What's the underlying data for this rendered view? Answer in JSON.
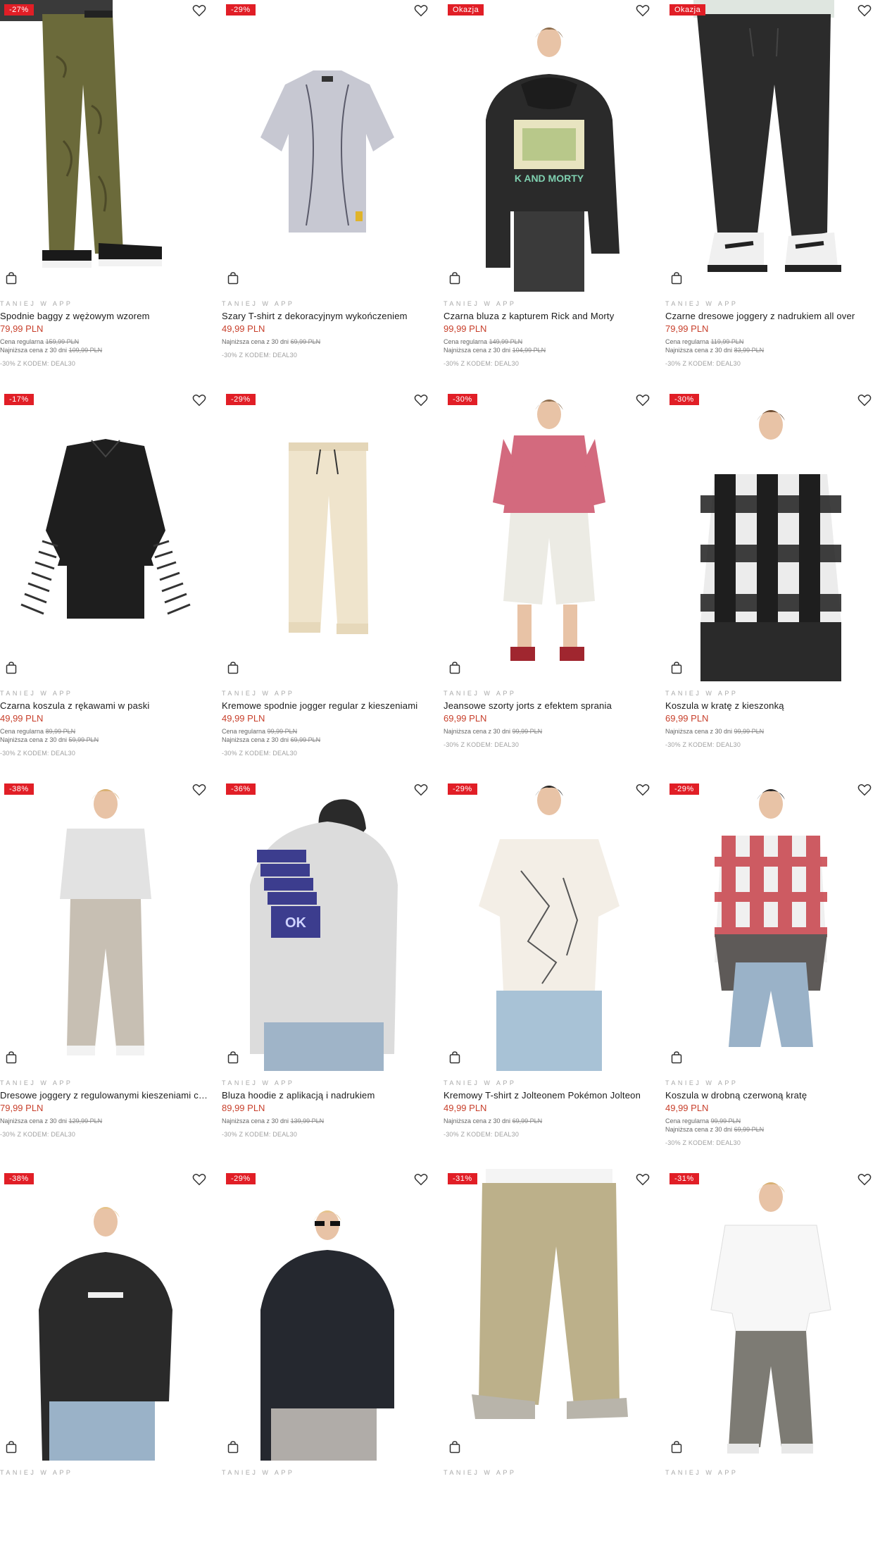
{
  "accent_badge": "#e11e26",
  "price_color": "#c8402c",
  "app_label": "TANIEJ W APP",
  "regular_label": "Cena regularna",
  "lowest_label": "Najniższa cena z 30 dni",
  "products": [
    {
      "badge": "-27%",
      "name": "Spodnie baggy z wężowym wzorem",
      "price": "79,99 PLN",
      "regular": "159,99 PLN",
      "lowest": "109,99 PLN",
      "code": "-30% Z KODEM: DEAL30",
      "image": "olive-snake-pants"
    },
    {
      "badge": "-29%",
      "name": "Szary T-shirt z dekoracyjnym wykończeniem",
      "price": "49,99 PLN",
      "regular": "",
      "lowest": "69,99 PLN",
      "code": "-30% Z KODEM: DEAL30",
      "image": "grey-tshirt"
    },
    {
      "badge": "Okazja",
      "name": "Czarna bluza z kapturem Rick and Morty",
      "price": "99,99 PLN",
      "regular": "149,99 PLN",
      "lowest": "104,99 PLN",
      "code": "-30% Z KODEM: DEAL30",
      "image": "black-hoodie-rick-morty"
    },
    {
      "badge": "Okazja",
      "name": "Czarne dresowe joggery z nadrukiem all over",
      "price": "79,99 PLN",
      "regular": "119,99 PLN",
      "lowest": "83,99 PLN",
      "code": "-30% Z KODEM: DEAL30",
      "image": "black-joggers"
    },
    {
      "badge": "-17%",
      "name": "Czarna koszula z rękawami w paski",
      "price": "49,99 PLN",
      "regular": "89,99 PLN",
      "lowest": "59,99 PLN",
      "code": "-30% Z KODEM: DEAL30",
      "image": "black-striped-shirt"
    },
    {
      "badge": "-29%",
      "name": "Kremowe spodnie jogger regular z kieszeniami",
      "price": "49,99 PLN",
      "regular": "99,99 PLN",
      "lowest": "69,99 PLN",
      "code": "-30% Z KODEM: DEAL30",
      "image": "cream-joggers"
    },
    {
      "badge": "-30%",
      "name": "Jeansowe szorty jorts z efektem sprania",
      "price": "69,99 PLN",
      "regular": "",
      "lowest": "99,99 PLN",
      "code": "-30% Z KODEM: DEAL30",
      "image": "jorts-model"
    },
    {
      "badge": "-30%",
      "name": "Koszula w kratę z kieszonką",
      "price": "69,99 PLN",
      "regular": "",
      "lowest": "99,99 PLN",
      "code": "-30% Z KODEM: DEAL30",
      "image": "check-shirt-model"
    },
    {
      "badge": "-38%",
      "name": "Dresowe joggery z regulowanymi kieszeniami cargo",
      "price": "79,99 PLN",
      "regular": "",
      "lowest": "129,99 PLN",
      "code": "-30% Z KODEM: DEAL30",
      "image": "grey-joggers-model"
    },
    {
      "badge": "-36%",
      "name": "Bluza hoodie z aplikacją i nadrukiem",
      "price": "89,99 PLN",
      "regular": "",
      "lowest": "139,99 PLN",
      "code": "-30% Z KODEM: DEAL30",
      "image": "grey-hoodie-back"
    },
    {
      "badge": "-29%",
      "name": "Kremowy T-shirt z Jolteonem Pokémon Jolteon",
      "price": "49,99 PLN",
      "regular": "",
      "lowest": "69,99 PLN",
      "code": "-30% Z KODEM: DEAL30",
      "image": "cream-tshirt-model"
    },
    {
      "badge": "-29%",
      "name": "Koszula w drobną czerwoną kratę",
      "price": "49,99 PLN",
      "regular": "99,99 PLN",
      "lowest": "69,99 PLN",
      "code": "-30% Z KODEM: DEAL30",
      "image": "red-check-shirt-model"
    },
    {
      "badge": "-38%",
      "name": "",
      "price": "",
      "regular": "",
      "lowest": "",
      "code": "",
      "image": "black-hoodie-model"
    },
    {
      "badge": "-29%",
      "name": "",
      "price": "",
      "regular": "",
      "lowest": "",
      "code": "",
      "image": "navy-hoodie-model"
    },
    {
      "badge": "-31%",
      "name": "",
      "price": "",
      "regular": "",
      "lowest": "",
      "code": "",
      "image": "khaki-pants-model"
    },
    {
      "badge": "-31%",
      "name": "",
      "price": "",
      "regular": "",
      "lowest": "",
      "code": "",
      "image": "white-shirt-model"
    }
  ]
}
